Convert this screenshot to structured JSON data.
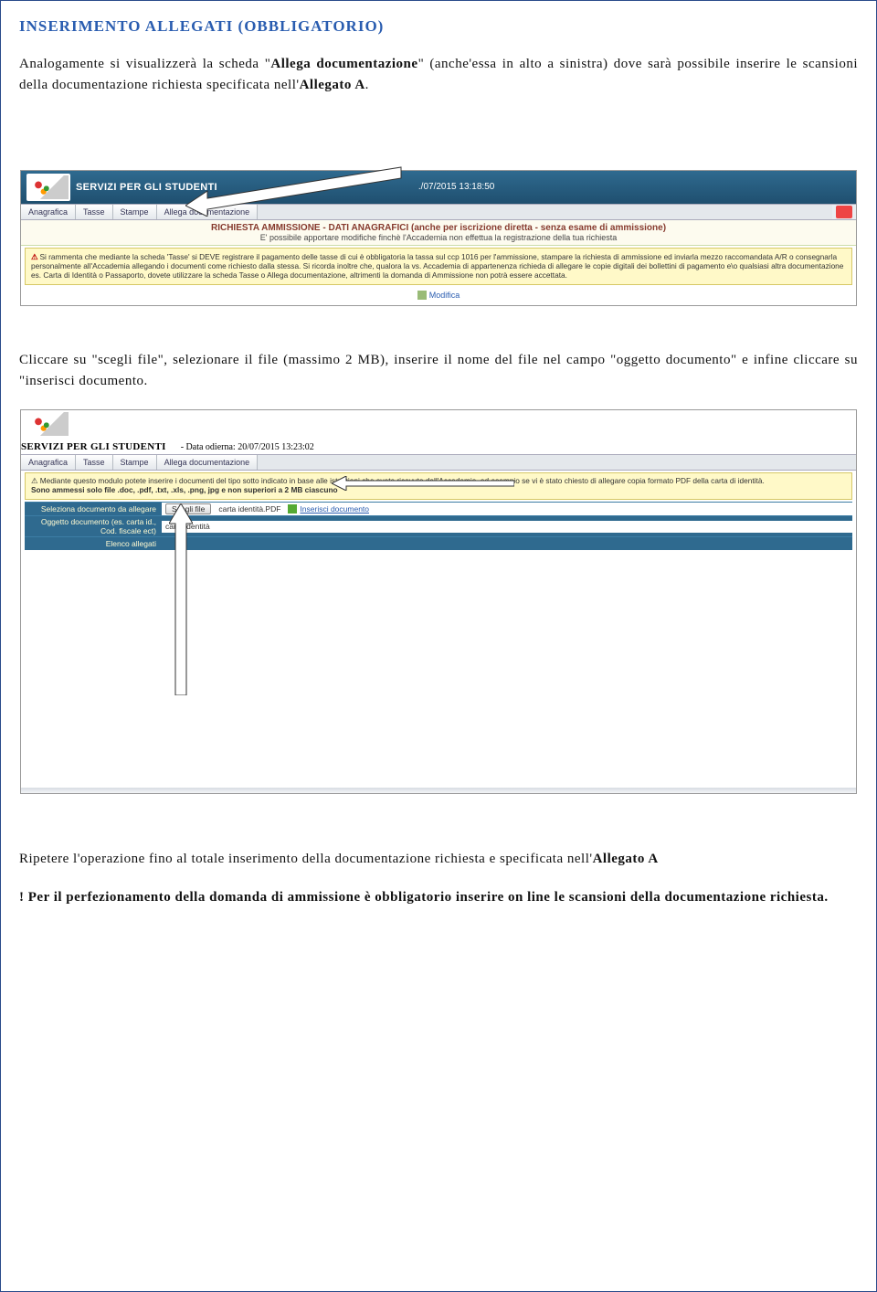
{
  "title": "INSERIMENTO ALLEGATI (OBBLIGATORIO)",
  "p1_a": "Analogamente si visualizzerà la scheda \"",
  "p1_b": "Allega documentazione",
  "p1_c": "\" (anche'essa in alto a sinistra) dove sarà possibile inserire le scansioni della documentazione richiesta specificata nell'",
  "p1_d": "Allegato A",
  "p1_e": ".",
  "p2": "Cliccare su \"scegli file\", selezionare il file (massimo 2 MB), inserire il nome del file nel campo \"oggetto documento\" e infine cliccare su \"inserisci documento.",
  "p3_a": "Ripetere l'operazione fino al totale inserimento della documentazione richiesta e specificata nell'",
  "p3_b": "Allegato A",
  "p4_a": "! ",
  "p4_b": "Per il perfezionamento della domanda di ammissione è obbligatorio inserire on line le scansioni della documentazione richiesta.",
  "shot1": {
    "brand": "SERVIZI PER GLI STUDENTI",
    "timestamp": "./07/2015 13:18:50",
    "tabs": [
      "Anagrafica",
      "Tasse",
      "Stampe",
      "Allega documentazione"
    ],
    "header": "RICHIESTA AMMISSIONE - DATI ANAGRAFICI (anche per iscrizione diretta - senza esame di ammissione)",
    "header_sub": "E' possibile apportare modifiche finchè l'Accademia non effettua la registrazione della tua richiesta",
    "notice": "Si rammenta che mediante la scheda 'Tasse' si DEVE registrare il pagamento delle tasse di cui è obbligatoria la tassa sul ccp 1016 per l'ammissione, stampare la richiesta di ammissione ed inviarla mezzo raccomandata A/R o consegnarla personalmente all'Accademia allegando i documenti come richiesto dalla stessa. Si ricorda inoltre che, qualora la vs. Accademia di appartenenza richieda di allegare le copie digitali dei bollettini di pagamento e\\o qualsiasi altra documentazione es. Carta di Identità o Passaporto, dovete utilizzare la scheda Tasse o Allega documentazione, altrimenti la domanda di Ammissione non potrà essere accettata.",
    "modifica": "Modifica"
  },
  "shot2": {
    "brand": "SERVIZI PER GLI STUDENTI",
    "timestamp": "- Data odierna: 20/07/2015 13:23:02",
    "tabs": [
      "Anagrafica",
      "Tasse",
      "Stampe",
      "Allega documentazione"
    ],
    "notice_l1": "Mediante questo modulo potete inserire i documenti del tipo sotto indicato in base alle istruzioni che avete ricevuto dall'Accademia, ad esempio se vi è stato chiesto di allegare copia formato PDF della carta di identità.",
    "notice_l2": "Sono ammessi solo file .doc, .pdf, .txt, .xls, .png, jpg e non superiori a 2 MB ciascuno",
    "row1_label": "Seleziona documento da allegare",
    "row1_btn": "Scegli file",
    "row1_file": "carta identità.PDF",
    "row1_link": "Inserisci documento",
    "row2_label": "Oggetto documento (es. carta id., Cod. fiscale ect)",
    "row2_val": "carta identità",
    "row3_label": "Elenco allegati"
  }
}
